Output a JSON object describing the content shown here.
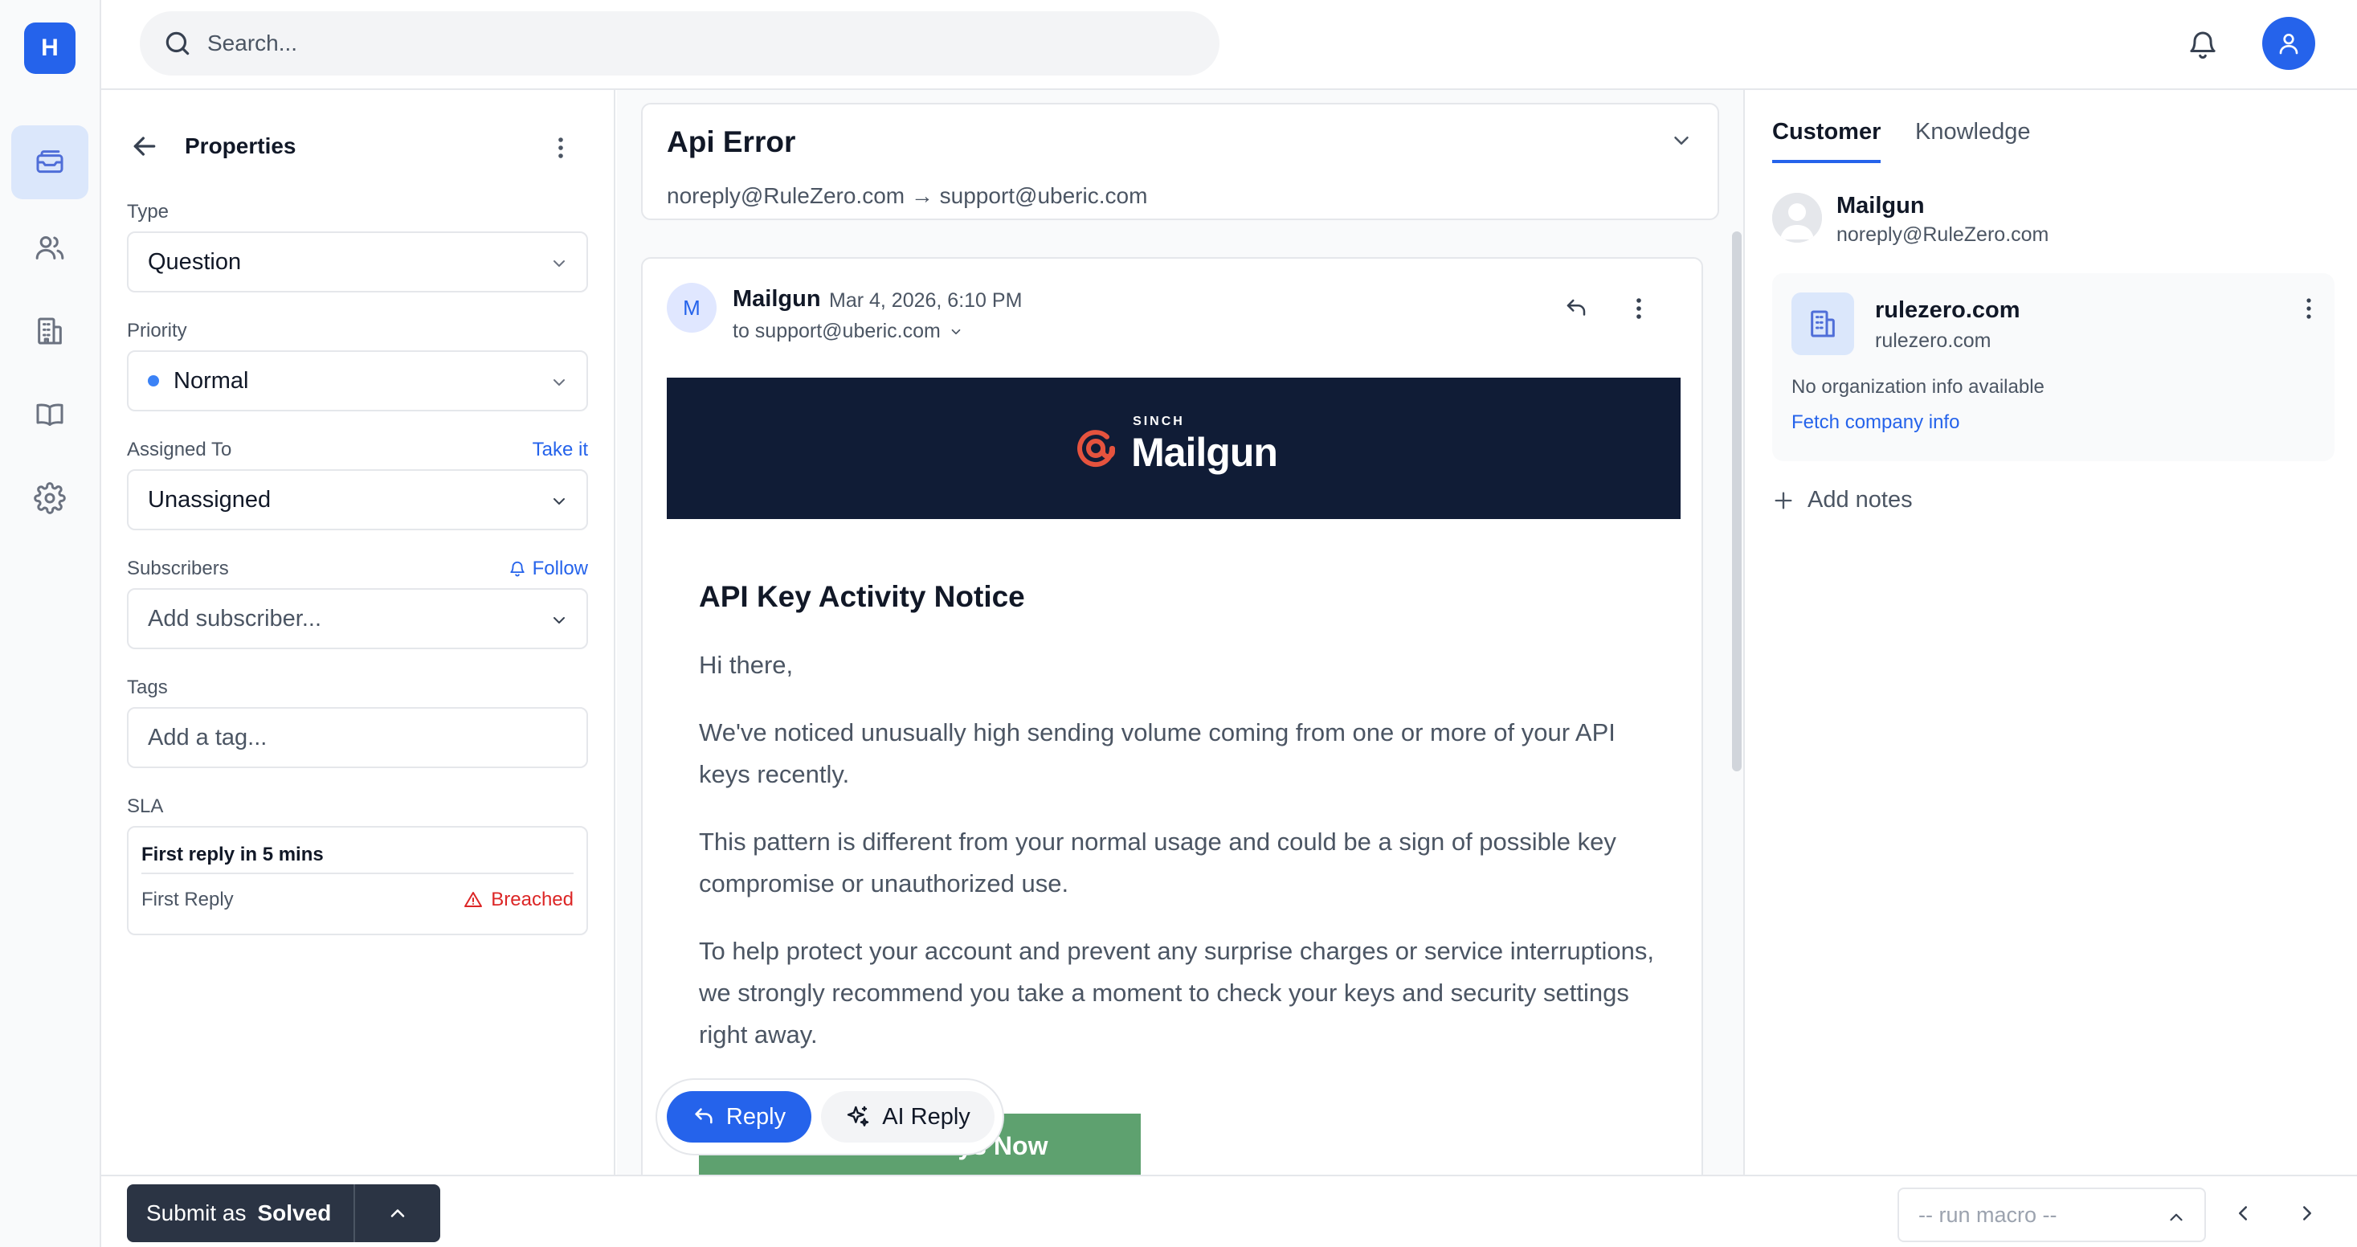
{
  "app": {
    "logo_letter": "H"
  },
  "rail": {
    "items": [
      {
        "name": "tickets-icon"
      },
      {
        "name": "customers-icon"
      },
      {
        "name": "organizations-icon"
      },
      {
        "name": "knowledge-base-icon"
      },
      {
        "name": "settings-icon"
      }
    ]
  },
  "topbar": {
    "search_placeholder": "Search..."
  },
  "properties": {
    "title": "Properties",
    "type": {
      "label": "Type",
      "value": "Question"
    },
    "priority": {
      "label": "Priority",
      "value": "Normal",
      "dot_color": "#3b82f6"
    },
    "assigned": {
      "label": "Assigned To",
      "action": "Take it",
      "value": "Unassigned"
    },
    "subscribers": {
      "label": "Subscribers",
      "action": "Follow",
      "placeholder": "Add subscriber..."
    },
    "tags": {
      "label": "Tags",
      "placeholder": "Add a tag..."
    },
    "sla": {
      "label": "SLA",
      "title": "First reply in 5 mins",
      "row_label": "First Reply",
      "status": "Breached"
    }
  },
  "conversation": {
    "subject": "Api Error",
    "route": "noreply@RuleZero.com → support@uberic.com",
    "message": {
      "avatar_letter": "M",
      "sender": "Mailgun",
      "date": "Mar 4, 2026, 6:10 PM",
      "to": "to support@uberic.com",
      "banner": {
        "sinch": "SINCH",
        "brand": "Mailgun"
      },
      "heading": "API Key Activity Notice",
      "paragraphs": [
        "Hi there,",
        "We've noticed unusually high sending volume coming from one or more of your API keys recently.",
        "This pattern is different from your normal usage and could be a sign of possible key compromise or unauthorized use.",
        "To help protect your account and prevent any surprise charges or service interruptions, we strongly recommend you take a moment to check your keys and security settings right away."
      ],
      "cta": "Check API Keys Now"
    },
    "reply_label": "Reply",
    "ai_reply_label": "AI Reply"
  },
  "right": {
    "tabs": [
      "Customer",
      "Knowledge"
    ],
    "customer": {
      "name": "Mailgun",
      "email": "noreply@RuleZero.com"
    },
    "org": {
      "name": "rulezero.com",
      "domain": "rulezero.com",
      "info": "No organization info available",
      "fetch": "Fetch company info"
    },
    "add_notes": "Add notes"
  },
  "bottom": {
    "submit_prefix": "Submit as",
    "submit_status": "Solved",
    "macro_placeholder": "-- run macro --"
  },
  "colors": {
    "accent": "#2563eb",
    "breached": "#dc2626",
    "banner": "#101c36",
    "cta": "#5ea16f"
  }
}
